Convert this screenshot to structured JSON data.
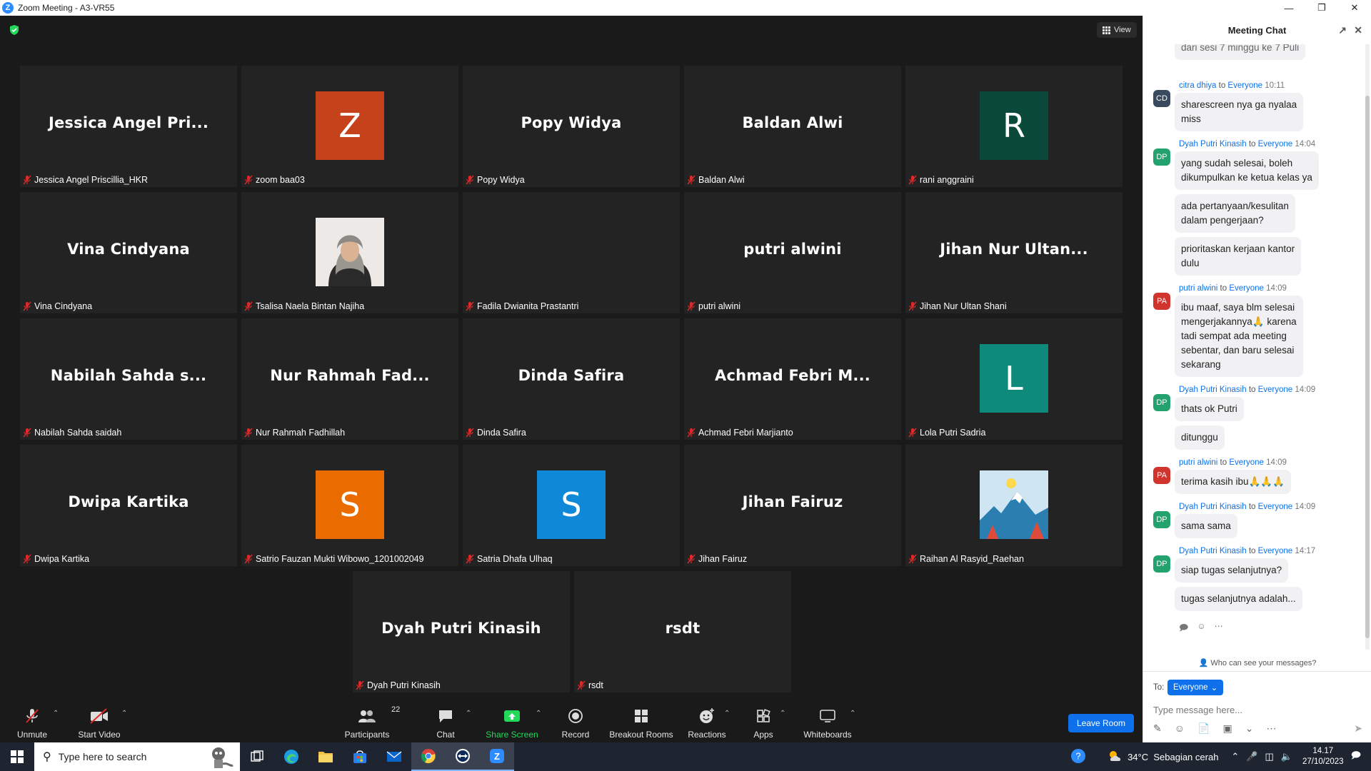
{
  "window": {
    "title": "Zoom Meeting - A3-VR55"
  },
  "stage": {
    "view_label": "View"
  },
  "participants": [
    {
      "display": "Jessica Angel Pri...",
      "label": "Jessica Angel Priscillia_HKR",
      "type": "name"
    },
    {
      "display": "Z",
      "label": "zoom baa03",
      "type": "letter",
      "color": "#c6421b"
    },
    {
      "display": "Popy Widya",
      "label": "Popy Widya",
      "type": "name"
    },
    {
      "display": "Baldan Alwi",
      "label": "Baldan Alwi",
      "type": "name"
    },
    {
      "display": "R",
      "label": "rani anggraini",
      "type": "letter",
      "color": "#0b4a3a"
    },
    {
      "display": "Vina Cindyana",
      "label": "Vina Cindyana",
      "type": "name"
    },
    {
      "display": "",
      "label": "Tsalisa Naela Bintan Najiha",
      "type": "photo"
    },
    {
      "display": "",
      "label": "Fadila Dwianita Prastantri",
      "type": "blank"
    },
    {
      "display": "putri alwini",
      "label": "putri alwini",
      "type": "name"
    },
    {
      "display": "Jihan Nur Ultan...",
      "label": "Jihan Nur Ultan Shani",
      "type": "name"
    },
    {
      "display": "Nabilah Sahda s...",
      "label": "Nabilah Sahda saidah",
      "type": "name"
    },
    {
      "display": "Nur Rahmah Fad...",
      "label": "Nur Rahmah Fadhillah",
      "type": "name"
    },
    {
      "display": "Dinda Safira",
      "label": "Dinda Safira",
      "type": "name"
    },
    {
      "display": "Achmad Febri M...",
      "label": "Achmad Febri Marjianto",
      "type": "name"
    },
    {
      "display": "L",
      "label": "Lola Putri Sadria",
      "type": "letter",
      "color": "#0d8a7a"
    },
    {
      "display": "Dwipa Kartika",
      "label": "Dwipa Kartika",
      "type": "name"
    },
    {
      "display": "S",
      "label": "Satrio Fauzan Mukti Wibowo_1201002049",
      "type": "letter",
      "color": "#ea6b00"
    },
    {
      "display": "S",
      "label": "Satria Dhafa Ulhaq",
      "type": "letter",
      "color": "#0f88d8"
    },
    {
      "display": "Jihan Fairuz",
      "label": "Jihan Fairuz",
      "type": "name"
    },
    {
      "display": "",
      "label": "Raihan Al Rasyid_Raehan",
      "type": "landscape"
    },
    {
      "display": "Dyah Putri Kinasih",
      "label": "Dyah Putri Kinasih",
      "type": "name"
    },
    {
      "display": "rsdt",
      "label": "rsdt",
      "type": "name"
    }
  ],
  "toolbar": {
    "unmute": "Unmute",
    "start_video": "Start Video",
    "participants": "Participants",
    "participants_count": "22",
    "chat": "Chat",
    "share_screen": "Share Screen",
    "record": "Record",
    "breakout": "Breakout Rooms",
    "reactions": "Reactions",
    "apps": "Apps",
    "whiteboards": "Whiteboards",
    "leave": "Leave Room"
  },
  "chat": {
    "title": "Meeting Chat",
    "truncated_top": "dari sesi 7 minggu ke 7 Puli",
    "messages": [
      {
        "sender": "citra dhiya",
        "to": "to",
        "recipient": "Everyone",
        "time": "10:11",
        "initials": "CD",
        "avatar_color": "#3a4a5e",
        "bubbles": [
          "sharescreen nya ga nyalaa\nmiss"
        ]
      },
      {
        "sender": "Dyah Putri Kinasih",
        "to": "to",
        "recipient": "Everyone",
        "time": "14:04",
        "initials": "DP",
        "avatar_color": "#23a26d",
        "bubbles": [
          "yang sudah selesai, boleh\ndikumpulkan ke ketua kelas ya",
          "ada pertanyaan/kesulitan\ndalam pengerjaan?",
          "prioritaskan kerjaan kantor\ndulu"
        ]
      },
      {
        "sender": "putri alwini",
        "to": "to",
        "recipient": "Everyone",
        "time": "14:09",
        "initials": "PA",
        "avatar_color": "#d0342c",
        "bubbles": [
          "ibu maaf, saya blm selesai\nmengerjakannya🙏 karena\ntadi sempat ada meeting\nsebentar, dan baru selesai\nsekarang"
        ]
      },
      {
        "sender": "Dyah Putri Kinasih",
        "to": "to",
        "recipient": "Everyone",
        "time": "14:09",
        "initials": "DP",
        "avatar_color": "#23a26d",
        "bubbles": [
          "thats ok Putri",
          "ditunggu"
        ]
      },
      {
        "sender": "putri alwini",
        "to": "to",
        "recipient": "Everyone",
        "time": "14:09",
        "initials": "PA",
        "avatar_color": "#d0342c",
        "bubbles": [
          "terima kasih ibu🙏🙏🙏"
        ]
      },
      {
        "sender": "Dyah Putri Kinasih",
        "to": "to",
        "recipient": "Everyone",
        "time": "14:09",
        "initials": "DP",
        "avatar_color": "#23a26d",
        "bubbles": [
          "sama sama"
        ]
      },
      {
        "sender": "Dyah Putri Kinasih",
        "to": "to",
        "recipient": "Everyone",
        "time": "14:17",
        "initials": "DP",
        "avatar_color": "#23a26d",
        "bubbles": [
          "siap tugas selanjutnya?",
          "tugas selanjutnya adalah..."
        ]
      }
    ],
    "who_can_see": "Who can see your messages?",
    "to_label": "To:",
    "to_value": "Everyone",
    "input_placeholder": "Type message here..."
  },
  "taskbar": {
    "search_placeholder": "Type here to search",
    "weather": "34°C  Sebagian cerah",
    "time": "14.17",
    "date": "27/10/2023"
  },
  "colors": {
    "accent": "#0e71eb",
    "share_green": "#23d959",
    "muted_red": "#e02828"
  }
}
